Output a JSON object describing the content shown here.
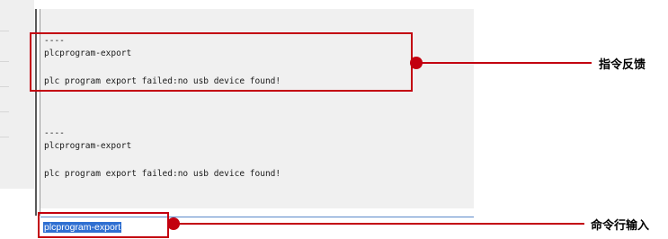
{
  "console": {
    "lines": [
      "----",
      "plcprogram-export",
      "plc program export failed:no usb device found!",
      "----",
      "plcprogram-export",
      "plc program export failed:no usb device found!"
    ]
  },
  "command_input": {
    "value": "plcprogram-export"
  },
  "annotations": {
    "feedback_label": "指令反馈",
    "command_line_label": "命令行输入",
    "color": "#c3000f"
  }
}
